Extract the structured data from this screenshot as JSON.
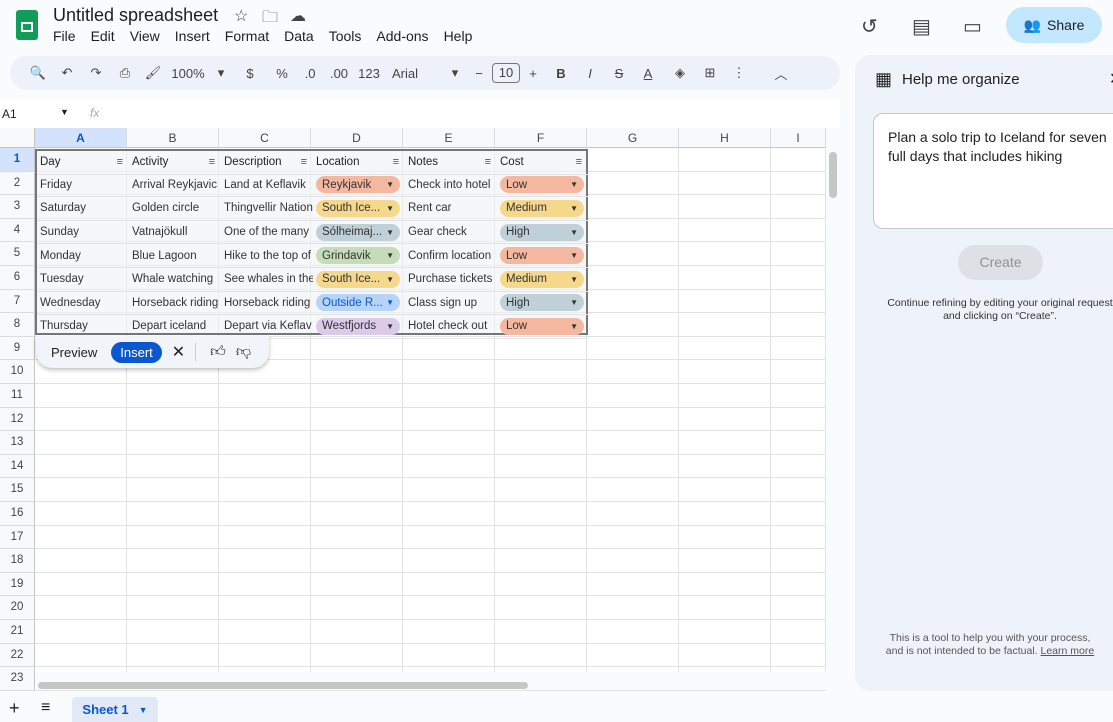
{
  "app": {
    "title": "Untitled spreadsheet",
    "menu": [
      "File",
      "Edit",
      "View",
      "Insert",
      "Format",
      "Data",
      "Tools",
      "Add-ons",
      "Help"
    ],
    "share_label": "Share"
  },
  "toolbar": {
    "zoom": "100%",
    "currency": "$",
    "percent": "%",
    "dec_decrease": ".0",
    "dec_increase": ".00",
    "format_123": "123",
    "font": "Arial",
    "font_size": "10"
  },
  "formula_bar": {
    "cell_ref": "A1",
    "fx": "fx"
  },
  "columns": [
    "A",
    "B",
    "C",
    "D",
    "E",
    "F",
    "G",
    "H",
    "I"
  ],
  "rows": [
    "1",
    "2",
    "3",
    "4",
    "5",
    "6",
    "7",
    "8",
    "9",
    "10",
    "11",
    "12",
    "13",
    "14",
    "15",
    "16",
    "17",
    "18",
    "19",
    "20",
    "21",
    "22",
    "23"
  ],
  "table": {
    "headers": [
      "Day",
      "Activity",
      "Description",
      "Location",
      "Notes",
      "Cost"
    ],
    "rows": [
      [
        "Friday",
        "Arrival Reykjavic",
        "Land at Keflavik",
        "Reykjavik",
        "Check into hotel",
        "Low"
      ],
      [
        "Saturday",
        "Golden circle",
        "Thingvellir Nation",
        "South Ice...",
        "Rent car",
        "Medium"
      ],
      [
        "Sunday",
        "Vatnajökull",
        "One of the many",
        "Sólheimaj...",
        "Gear check",
        "High"
      ],
      [
        "Monday",
        "Blue Lagoon",
        "Hike to the top of",
        "Grindavik",
        "Confirm location",
        "Low"
      ],
      [
        "Tuesday",
        "Whale watching",
        "See whales in the",
        "South Ice...",
        "Purchase tickets",
        "Medium"
      ],
      [
        "Wednesday",
        "Horseback riding",
        "Horseback riding",
        "Outside R...",
        "Class sign up",
        "High"
      ],
      [
        "Thursday",
        "Depart iceland",
        "Depart via Keflav",
        "Westfjords",
        "Hotel check out",
        "Low"
      ]
    ],
    "location_colors": [
      "#f4b8a0",
      "#f6d88c",
      "#bfd0d8",
      "#c4dcb8",
      "#f6d88c",
      "#b6d3f8",
      "#dccbe8"
    ],
    "cost_colors": {
      "Low": "#f4b8a0",
      "Medium": "#f6d88c",
      "High": "#bfd0d8"
    }
  },
  "suggestion_bar": {
    "preview": "Preview",
    "insert": "Insert"
  },
  "panel": {
    "title": "Help me organize",
    "prompt": "Plan a solo trip to Iceland for seven full days that includes hiking",
    "create": "Create",
    "refine_note_1": "Continue refining by editing your original request",
    "refine_note_2": "and clicking on “Create”.",
    "disclaimer_1": "This is a tool to help you with your process,",
    "disclaimer_2": "and is not intended to be factual.",
    "learn_more": "Learn more"
  },
  "sheets": [
    "Sheet 1"
  ]
}
